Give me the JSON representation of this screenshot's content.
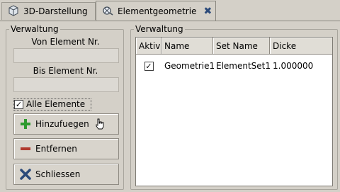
{
  "tabs": [
    {
      "label": "3D-Darstellung",
      "icon": "cube-icon"
    },
    {
      "label": "Elementgeometrie",
      "icon": "geometry-icon",
      "close_icon": "close-icon"
    }
  ],
  "left_group": {
    "title": "Verwaltung",
    "from_label": "Von Element Nr.",
    "from_value": "",
    "to_label": "Bis Element Nr.",
    "to_value": "",
    "all_elements_label": "Alle Elemente",
    "all_elements_checked": true,
    "buttons": {
      "add": "Hinzufuegen",
      "remove": "Entfernen",
      "close": "Schliessen"
    }
  },
  "right_group": {
    "title": "Verwaltung",
    "columns": [
      "Aktiv",
      "Name",
      "Set Name",
      "Dicke"
    ],
    "rows": [
      {
        "aktiv": true,
        "name": "Geometrie1",
        "set_name": "ElementSet1",
        "dicke": "1.000000"
      }
    ]
  },
  "colors": {
    "add_icon": "#2e9a2e",
    "remove_icon": "#b03a2e",
    "close_icon": "#2b4a7a"
  }
}
